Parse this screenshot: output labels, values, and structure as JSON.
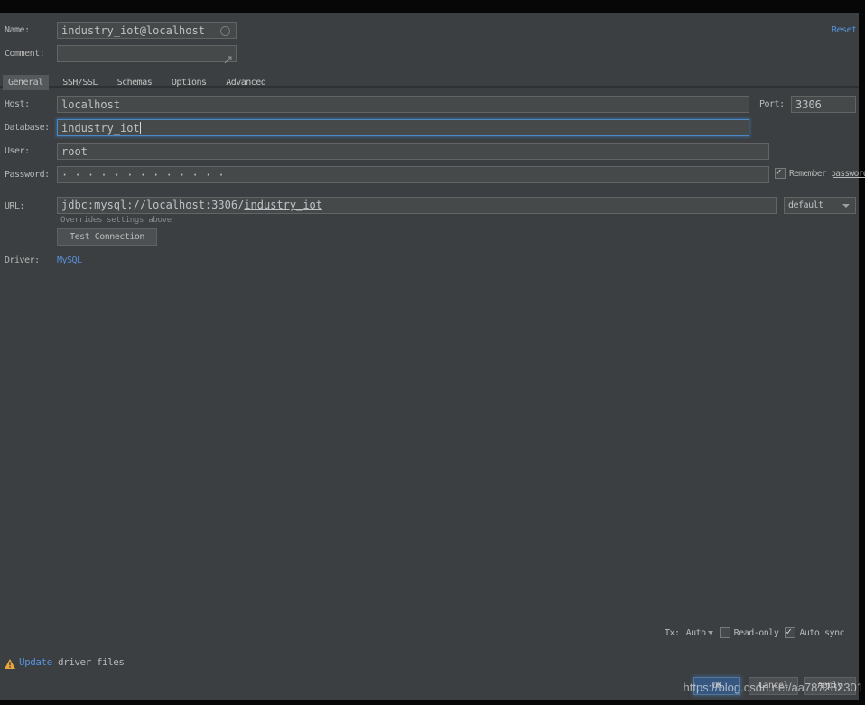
{
  "header": {
    "name_label": "Name:",
    "name_value": "industry_iot@localhost",
    "comment_label": "Comment:",
    "comment_value": "",
    "reset_label": "Reset"
  },
  "tabs": [
    {
      "label": "General",
      "selected": true
    },
    {
      "label": "SSH/SSL",
      "selected": false
    },
    {
      "label": "Schemas",
      "selected": false
    },
    {
      "label": "Options",
      "selected": false
    },
    {
      "label": "Advanced",
      "selected": false
    }
  ],
  "general": {
    "host_label": "Host:",
    "host_value": "localhost",
    "port_label": "Port:",
    "port_value": "3306",
    "database_label": "Database:",
    "database_value": "industry_iot",
    "user_label": "User:",
    "user_value": "root",
    "password_label": "Password:",
    "password_masked": "· · · · · · · · · · · · ·",
    "remember_password_prefix": "Remember ",
    "remember_password_mnemonic": "password",
    "remember_password_checked": true,
    "url_label": "URL:",
    "url_prefix": "jdbc:mysql://localhost:3306/",
    "url_database": "industry_iot",
    "url_hint": "Overrides settings above",
    "url_scope_value": "default",
    "test_connection_label": "Test Connection",
    "driver_label": "Driver:",
    "driver_value": "MySQL"
  },
  "footer": {
    "tx_label": "Tx:",
    "tx_value": "Auto",
    "readonly_label": "Read-only",
    "readonly_checked": false,
    "autosync_label": "Auto sync",
    "autosync_checked": true,
    "warning_link": "Update",
    "warning_rest": "driver files",
    "ok_label": "OK",
    "cancel_label": "Cancel",
    "apply_label": "Apply"
  },
  "watermark": "https://blog.csdn.net/aa787282301",
  "colors": {
    "dialog_bg": "#3c3f41",
    "field_bg": "#45494a",
    "field_border": "#646464",
    "focus_border": "#4a88c7",
    "link_blue": "#5691d8",
    "warning_orange": "#e9a63c",
    "ok_button_bg": "#365880",
    "selected_tab_bg": "#54585a"
  }
}
